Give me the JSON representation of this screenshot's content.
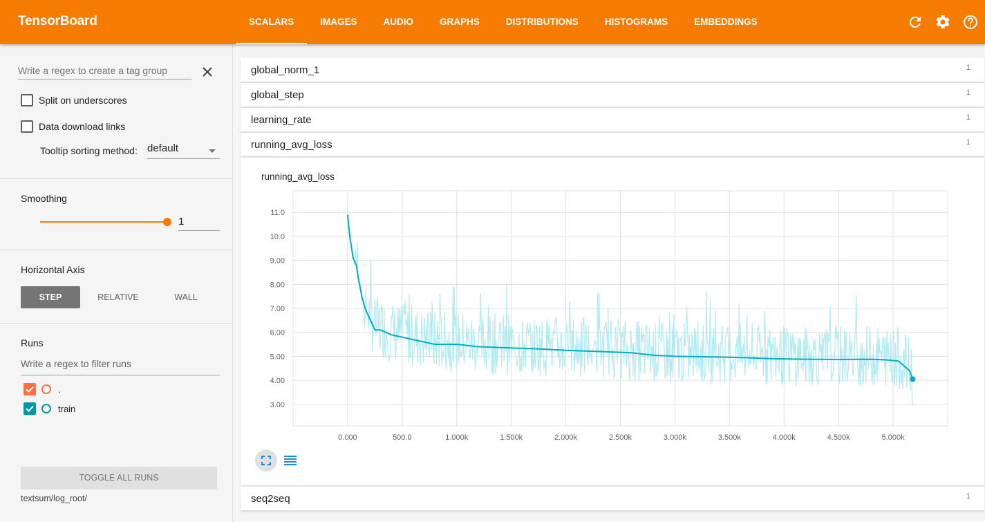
{
  "header": {
    "title": "TensorBoard",
    "tabs": [
      "SCALARS",
      "IMAGES",
      "AUDIO",
      "GRAPHS",
      "DISTRIBUTIONS",
      "HISTOGRAMS",
      "EMBEDDINGS"
    ],
    "active_tab": "SCALARS",
    "icons": [
      "refresh-icon",
      "settings-icon",
      "help-icon"
    ],
    "accent_color": "#f57c00"
  },
  "sidebar": {
    "tag_group_placeholder": "Write a regex to create a tag group",
    "split_label": "Split on underscores",
    "download_label": "Data download links",
    "tooltip_label": "Tooltip sorting method:",
    "tooltip_value": "default",
    "smoothing_title": "Smoothing",
    "smoothing_value": "1",
    "smoothing_fraction": 1.0,
    "haxis_title": "Horizontal Axis",
    "haxis_options": [
      "STEP",
      "RELATIVE",
      "WALL"
    ],
    "haxis_active": "STEP",
    "runs_title": "Runs",
    "runs_placeholder": "Write a regex to filter runs",
    "runs": [
      {
        "name": ".",
        "color": "#ff7043",
        "checked": true
      },
      {
        "name": "train",
        "color": "#0097a7",
        "checked": true
      }
    ],
    "toggle_label": "TOGGLE ALL RUNS",
    "log_dir": "textsum/log_root/"
  },
  "tags": [
    {
      "name": "global_norm_1",
      "count": "1"
    },
    {
      "name": "global_step",
      "count": "1"
    },
    {
      "name": "learning_rate",
      "count": "1"
    },
    {
      "name": "running_avg_loss",
      "count": "1"
    },
    {
      "name": "seq2seq",
      "count": "1"
    }
  ],
  "chart_data": {
    "type": "line",
    "title": "running_avg_loss",
    "xlabel": "",
    "ylabel": "",
    "x_ticks": [
      "0.000",
      "500.0",
      "1.000k",
      "1.500k",
      "2.000k",
      "2.500k",
      "3.000k",
      "3.500k",
      "4.000k",
      "4.500k",
      "5.000k"
    ],
    "y_ticks": [
      "3.00",
      "4.00",
      "5.00",
      "6.00",
      "7.00",
      "8.00",
      "9.00",
      "10.0",
      "11.0"
    ],
    "xlim": [
      -500,
      5500
    ],
    "ylim": [
      2.1,
      11.9
    ],
    "grid": true,
    "series": [
      {
        "color": "#00acc1",
        "raw_color": "#b2ebf2",
        "x": [
          0,
          20,
          50,
          80,
          100,
          130,
          160,
          200,
          250,
          300,
          400,
          500,
          600,
          700,
          800,
          1000,
          1200,
          1500,
          1800,
          2000,
          2300,
          2600,
          2800,
          3000,
          3300,
          3600,
          3900,
          4200,
          4500,
          4800,
          4950,
          5050,
          5100,
          5150,
          5180
        ],
        "y": [
          10.9,
          10.0,
          9.1,
          8.8,
          8.2,
          7.5,
          7.0,
          6.6,
          6.1,
          6.1,
          5.9,
          5.8,
          5.7,
          5.6,
          5.5,
          5.5,
          5.4,
          5.35,
          5.3,
          5.25,
          5.2,
          5.15,
          5.05,
          5.0,
          4.98,
          4.95,
          4.9,
          4.88,
          4.87,
          4.88,
          4.85,
          4.8,
          4.6,
          4.4,
          4.05
        ]
      }
    ]
  }
}
